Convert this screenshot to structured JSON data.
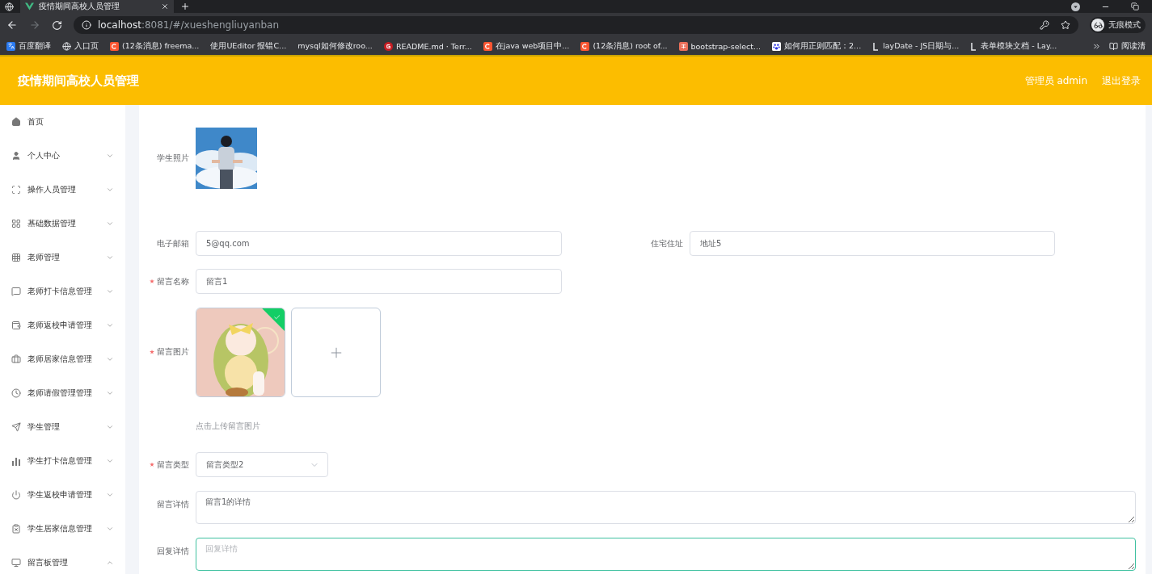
{
  "browser": {
    "tab_title": "疫情期间高校人员管理",
    "url_host": "localhost",
    "url_rest": ":8081/#/xueshengliuyanban",
    "profile_label": "无痕模式",
    "bookmarks": [
      {
        "label": "百度翻译",
        "kind": "translate"
      },
      {
        "label": "入口页",
        "kind": "globe"
      },
      {
        "label": "(12条消息) freema...",
        "kind": "csdn"
      },
      {
        "label": "使用UEditor 报错C...",
        "kind": "blank"
      },
      {
        "label": "mysql如何修改roo...",
        "kind": "blank"
      },
      {
        "label": "README.md · Terr...",
        "kind": "gitee"
      },
      {
        "label": "在java web项目中...",
        "kind": "csdn"
      },
      {
        "label": "(12条消息) root of...",
        "kind": "csdn"
      },
      {
        "label": "bootstrap-select...",
        "kind": "jian"
      },
      {
        "label": "如何用正则匹配：2...",
        "kind": "baidu"
      },
      {
        "label": "layDate - JS日期与...",
        "kind": "layui"
      },
      {
        "label": "表单模块文档 - Lay...",
        "kind": "layui"
      }
    ],
    "reading_list": "阅读清"
  },
  "header": {
    "title": "疫情期间高校人员管理",
    "user": "管理员 admin",
    "logout": "退出登录"
  },
  "sidebar": {
    "items": [
      {
        "label": "首页",
        "kind": "link"
      },
      {
        "label": "个人中心",
        "kind": "submenu",
        "expanded": false
      },
      {
        "label": "操作人员管理",
        "kind": "submenu",
        "expanded": false
      },
      {
        "label": "基础数据管理",
        "kind": "submenu",
        "expanded": false
      },
      {
        "label": "老师管理",
        "kind": "submenu",
        "expanded": false
      },
      {
        "label": "老师打卡信息管理",
        "kind": "submenu",
        "expanded": false
      },
      {
        "label": "老师返校申请管理",
        "kind": "submenu",
        "expanded": false
      },
      {
        "label": "老师居家信息管理",
        "kind": "submenu",
        "expanded": false
      },
      {
        "label": "老师请假管理管理",
        "kind": "submenu",
        "expanded": false
      },
      {
        "label": "学生管理",
        "kind": "submenu",
        "expanded": false
      },
      {
        "label": "学生打卡信息管理",
        "kind": "submenu",
        "expanded": false
      },
      {
        "label": "学生返校申请管理",
        "kind": "submenu",
        "expanded": false
      },
      {
        "label": "学生居家信息管理",
        "kind": "submenu",
        "expanded": false
      },
      {
        "label": "留言板管理",
        "kind": "submenu",
        "expanded": true
      }
    ]
  },
  "form": {
    "rows": [
      {
        "label": "学生照片",
        "required": false
      },
      {
        "kind": "pair",
        "fields": [
          {
            "label": "电子邮箱",
            "value": "5@qq.com",
            "required": false
          },
          {
            "label": "住宅住址",
            "value": "地址5",
            "required": false
          }
        ]
      },
      {
        "kind": "input",
        "label": "留言名称",
        "value": "留言1",
        "required": true
      },
      {
        "kind": "upload",
        "label": "留言图片",
        "required": true,
        "uploaded": true,
        "hint": "点击上传留言图片"
      },
      {
        "kind": "select",
        "label": "留言类型",
        "value": "留言类型2",
        "required": true
      },
      {
        "kind": "textarea",
        "label": "留言详情",
        "value": "留言1的详情",
        "required": false,
        "focused": false
      },
      {
        "kind": "textarea",
        "label": "回复详情",
        "placeholder": "回复详情",
        "required": false,
        "focused": true
      }
    ]
  }
}
